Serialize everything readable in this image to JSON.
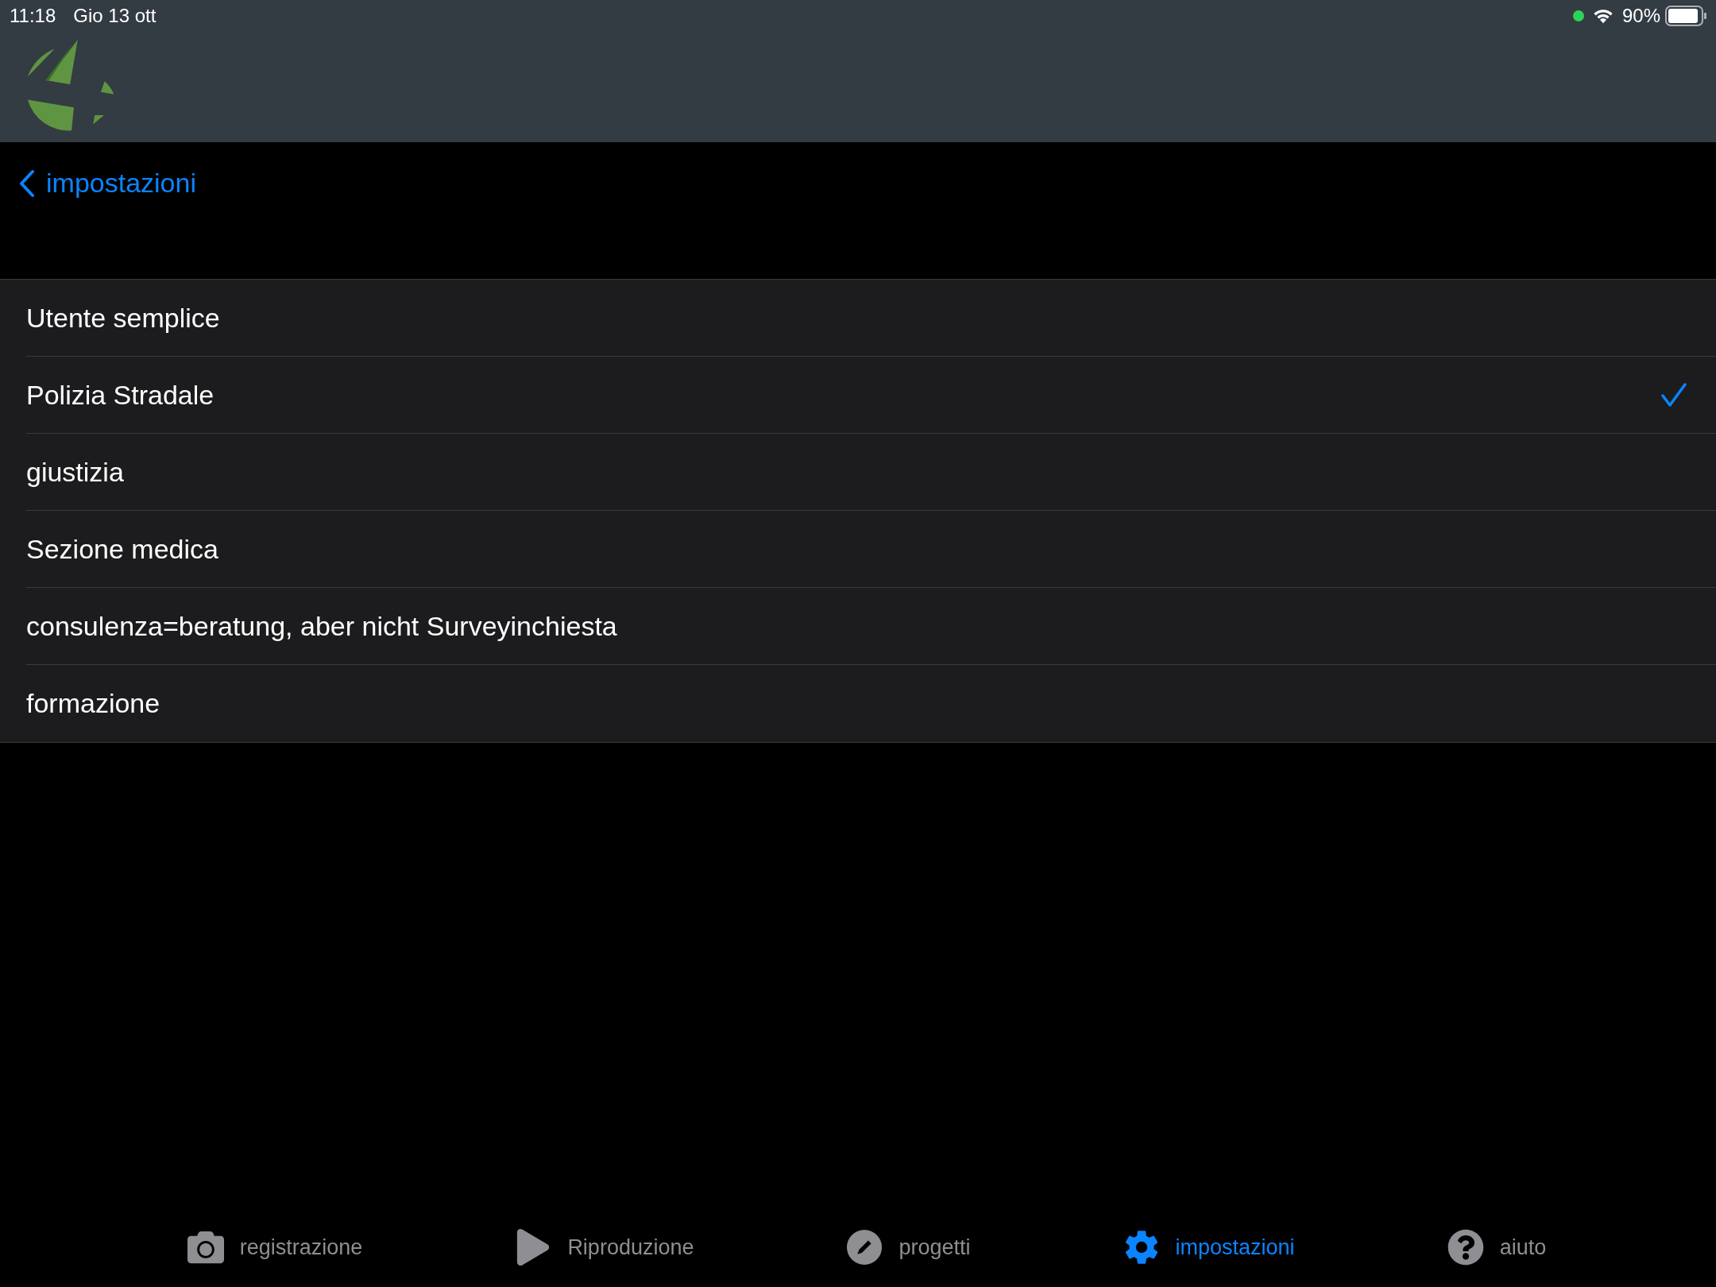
{
  "status_bar": {
    "time": "11:18",
    "date": "Gio 13 ott",
    "battery": "90%"
  },
  "navigation": {
    "back_label": "impostazioni"
  },
  "options": [
    {
      "label": "Utente semplice",
      "selected": false
    },
    {
      "label": "Polizia Stradale",
      "selected": true
    },
    {
      "label": "giustizia",
      "selected": false
    },
    {
      "label": "Sezione medica",
      "selected": false
    },
    {
      "label": "consulenza=beratung, aber nicht Surveyinchiesta",
      "selected": false
    },
    {
      "label": "formazione",
      "selected": false
    }
  ],
  "tab_bar": [
    {
      "kind": "camera",
      "label": "registrazione",
      "selected": false
    },
    {
      "kind": "play",
      "label": "Riproduzione",
      "selected": false
    },
    {
      "kind": "pencil",
      "label": "progetti",
      "selected": false
    },
    {
      "kind": "gear",
      "label": "impostazioni",
      "selected": true
    },
    {
      "kind": "help",
      "label": "aiuto",
      "selected": false
    }
  ]
}
